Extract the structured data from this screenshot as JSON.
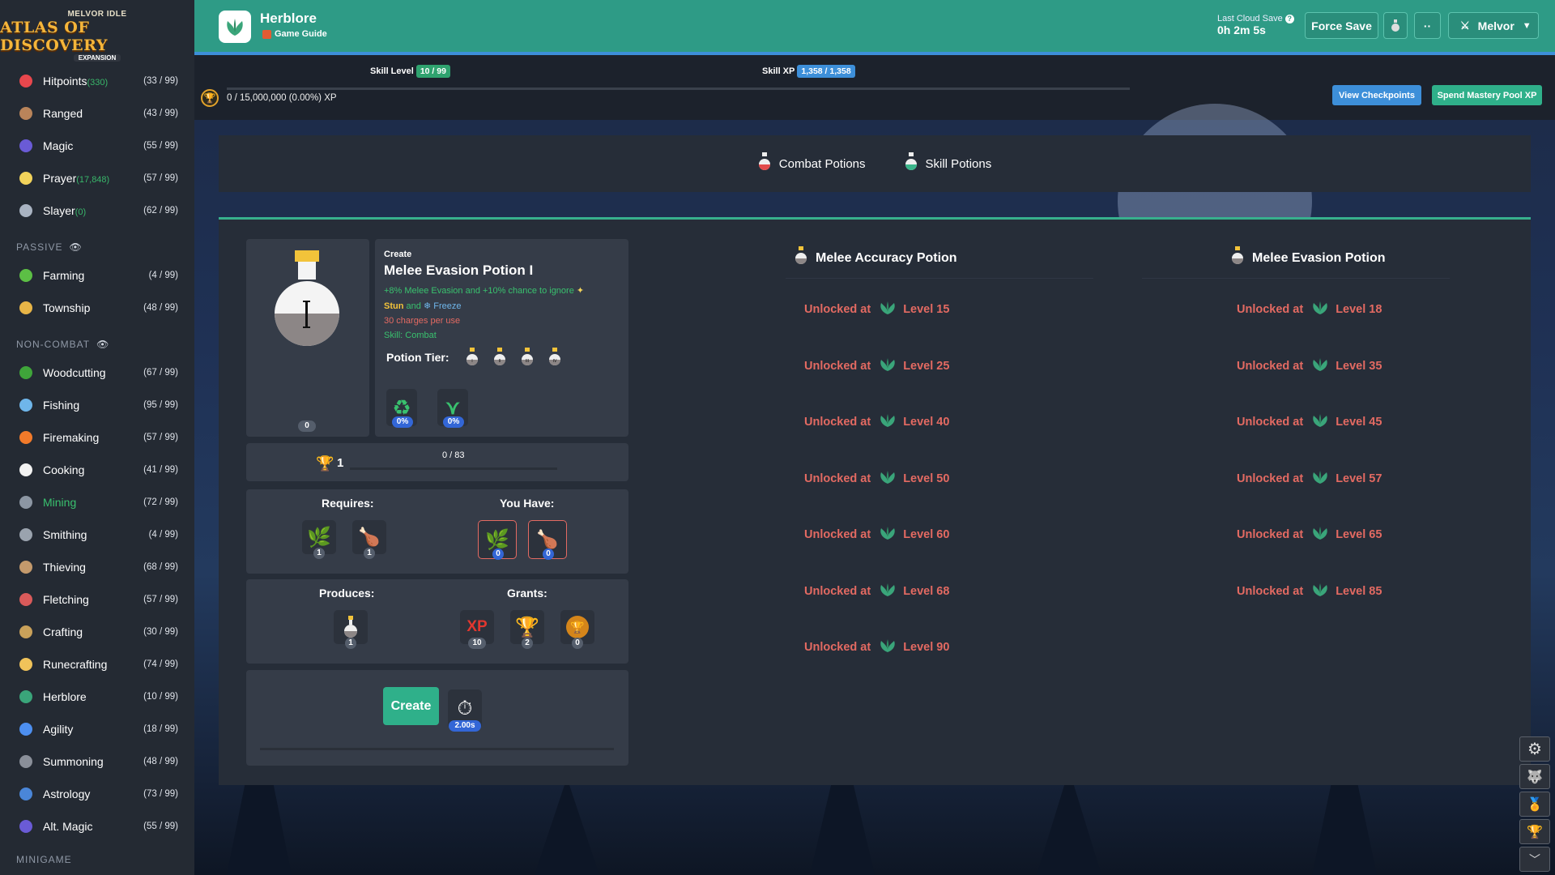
{
  "logo": {
    "line1": "MELVOR IDLE",
    "line2": "ATLAS OF DISCOVERY",
    "line3": "EXPANSION"
  },
  "sidebar": {
    "items_top": [
      {
        "name": "Hitpoints",
        "extra": "(330)",
        "level": "(33 / 99)",
        "icon": "heart-icon",
        "color": "#e8474d"
      },
      {
        "name": "Ranged",
        "extra": "",
        "level": "(43 / 99)",
        "icon": "bow-icon",
        "color": "#b9845a"
      },
      {
        "name": "Magic",
        "extra": "",
        "level": "(55 / 99)",
        "icon": "wizard-hat-icon",
        "color": "#6a5bd6"
      },
      {
        "name": "Prayer",
        "extra": "(17,848)",
        "level": "(57 / 99)",
        "icon": "sparkle-icon",
        "color": "#f2d35b"
      },
      {
        "name": "Slayer",
        "extra": "(0)",
        "level": "(62 / 99)",
        "icon": "slayer-helm-icon",
        "color": "#a9b3c2"
      }
    ],
    "passive_label": "PASSIVE",
    "items_passive": [
      {
        "name": "Farming",
        "extra": "",
        "level": "(4 / 99)",
        "icon": "sprout-icon",
        "color": "#5cbf45"
      },
      {
        "name": "Township",
        "extra": "",
        "level": "(48 / 99)",
        "icon": "township-icon",
        "color": "#e8b547"
      }
    ],
    "noncombat_label": "NON-COMBAT",
    "items_noncombat": [
      {
        "name": "Woodcutting",
        "extra": "",
        "level": "(67 / 99)",
        "icon": "tree-icon",
        "color": "#3fa53a"
      },
      {
        "name": "Fishing",
        "extra": "",
        "level": "(95 / 99)",
        "icon": "fish-icon",
        "color": "#6fb6ea"
      },
      {
        "name": "Firemaking",
        "extra": "",
        "level": "(57 / 99)",
        "icon": "fire-icon",
        "color": "#f27a2a"
      },
      {
        "name": "Cooking",
        "extra": "",
        "level": "(41 / 99)",
        "icon": "chef-hat-icon",
        "color": "#f2f2f2"
      },
      {
        "name": "Mining",
        "extra": "",
        "level": "(72 / 99)",
        "icon": "pickaxe-icon",
        "color": "#8c96a3",
        "active": true
      },
      {
        "name": "Smithing",
        "extra": "",
        "level": "(4 / 99)",
        "icon": "anvil-icon",
        "color": "#9aa3ae"
      },
      {
        "name": "Thieving",
        "extra": "",
        "level": "(68 / 99)",
        "icon": "thief-icon",
        "color": "#c49a6c"
      },
      {
        "name": "Fletching",
        "extra": "",
        "level": "(57 / 99)",
        "icon": "arrow-icon",
        "color": "#d95a5a"
      },
      {
        "name": "Crafting",
        "extra": "",
        "level": "(30 / 99)",
        "icon": "chisel-icon",
        "color": "#c9a15a"
      },
      {
        "name": "Runecrafting",
        "extra": "",
        "level": "(74 / 99)",
        "icon": "rune-icon",
        "color": "#f0c35a"
      },
      {
        "name": "Herblore",
        "extra": "",
        "level": "(10 / 99)",
        "icon": "herb-icon",
        "color": "#3aa57a"
      },
      {
        "name": "Agility",
        "extra": "",
        "level": "(18 / 99)",
        "icon": "running-icon",
        "color": "#4d8ff0"
      },
      {
        "name": "Summoning",
        "extra": "",
        "level": "(48 / 99)",
        "icon": "wolf-icon",
        "color": "#8a8f99"
      },
      {
        "name": "Astrology",
        "extra": "",
        "level": "(73 / 99)",
        "icon": "astrology-icon",
        "color": "#4a86d8"
      },
      {
        "name": "Alt. Magic",
        "extra": "",
        "level": "(55 / 99)",
        "icon": "alt-magic-icon",
        "color": "#6a5bd6"
      }
    ],
    "minigame_label": "MINIGAME"
  },
  "header": {
    "title": "Herblore",
    "subtitle": "Game Guide",
    "cloud_label": "Last Cloud Save",
    "cloud_time": "0h 2m 5s",
    "force_save": "Force Save",
    "more": "··",
    "user": "Melvor"
  },
  "skill": {
    "level_label": "Skill Level",
    "level_value": "10 / 99",
    "xp_label": "Skill XP",
    "xp_value": "1,358 / 1,358",
    "mastery_text": "0 / 15,000,000 (0.00%) XP",
    "view_checkpoints": "View Checkpoints",
    "spend_mastery": "Spend Mastery Pool XP"
  },
  "categories": [
    {
      "label": "Combat Potions",
      "icon": "red-potion-icon",
      "color": "#e24a4a"
    },
    {
      "label": "Skill Potions",
      "icon": "green-potion-icon",
      "color": "#3ab58a"
    }
  ],
  "create": {
    "small_title": "Create",
    "title": "Melee Evasion Potion I",
    "desc1": "+8% Melee Evasion and +10% chance to ignore",
    "stun": "Stun",
    "and": "and",
    "freeze": "Freeze",
    "charges": "30 charges per use",
    "skill": "Skill: Combat",
    "tier_label": "Potion Tier:",
    "tiers": [
      "I",
      "II",
      "III",
      "IV"
    ],
    "owned": "0",
    "mod1": "0%",
    "mod2": "0%",
    "mastery_level": "1",
    "mastery_progress": "0 / 83",
    "mastery_fraction": 0.0,
    "requires_label": "Requires:",
    "you_have_label": "You Have:",
    "requires": [
      {
        "icon": "herb-leaf-icon",
        "count": "1"
      },
      {
        "icon": "raw-chicken-icon",
        "count": "1"
      }
    ],
    "have": [
      {
        "icon": "herb-leaf-icon",
        "count": "0"
      },
      {
        "icon": "raw-chicken-icon",
        "count": "0"
      }
    ],
    "produces_label": "Produces:",
    "grants_label": "Grants:",
    "produces": [
      {
        "icon": "potion-icon",
        "count": "1"
      }
    ],
    "grants": [
      {
        "icon": "xp-icon",
        "text": "XP",
        "count": "10"
      },
      {
        "icon": "trophy-icon",
        "count": "2"
      },
      {
        "icon": "mastery-token-icon",
        "count": "0"
      }
    ],
    "create_button": "Create",
    "interval": "2.00s"
  },
  "potions": {
    "col1_title": "Melee Accuracy Potion",
    "col2_title": "Melee Evasion Potion",
    "unlocked_at": "Unlocked at",
    "col1": [
      "Level 15",
      "Level 25",
      "Level 40",
      "Level 50",
      "Level 60",
      "Level 68",
      "Level 90"
    ],
    "col2": [
      "Level 18",
      "Level 35",
      "Level 45",
      "Level 57",
      "Level 65",
      "Level 85"
    ]
  },
  "colors": {
    "accent": "#2e9b86",
    "unlock": "#e36a62",
    "green": "#39c16e",
    "blue": "#3d8fd9"
  }
}
